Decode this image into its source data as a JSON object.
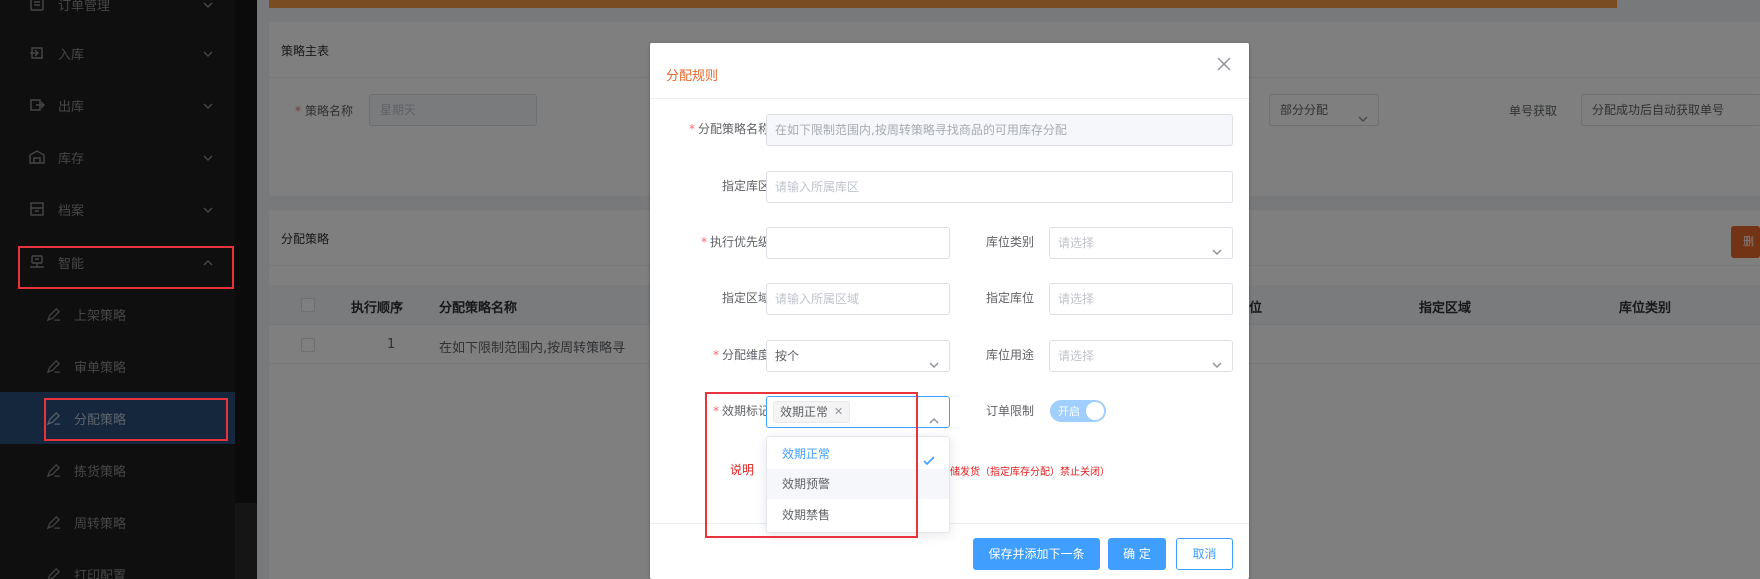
{
  "sidebar": {
    "items": [
      {
        "label": "订单管理",
        "icon": "order-icon"
      },
      {
        "label": "入库",
        "icon": "inbound-icon"
      },
      {
        "label": "出库",
        "icon": "outbound-icon"
      },
      {
        "label": "库存",
        "icon": "warehouse-icon"
      },
      {
        "label": "档案",
        "icon": "archive-icon"
      },
      {
        "label": "智能",
        "icon": "smart-icon"
      }
    ],
    "sub_items": [
      {
        "label": "上架策略",
        "icon": "edit-icon"
      },
      {
        "label": "审单策略",
        "icon": "edit-icon"
      },
      {
        "label": "分配策略",
        "icon": "edit-icon"
      },
      {
        "label": "拣货策略",
        "icon": "edit-icon"
      },
      {
        "label": "周转策略",
        "icon": "edit-icon"
      },
      {
        "label": "打印配置",
        "icon": "edit-icon"
      }
    ],
    "active_sub": "分配策略"
  },
  "background": {
    "card1_title": "策略主表",
    "strategy_name_label": "策略名称",
    "strategy_name_value": "星期天",
    "partial_alloc_value": "部分分配",
    "order_no_label": "单号获取",
    "order_no_value": "分配成功后自动获取单号",
    "card2_title": "分配策略",
    "table_headers": [
      "执行顺序",
      "分配策略名称",
      "位",
      "指定区域",
      "库位类别"
    ],
    "table_row": {
      "order": "1",
      "name": "在如下限制范围内,按周转策略寻"
    },
    "delete_label": "删"
  },
  "dialog": {
    "title": "分配规则",
    "fields": {
      "strategy_name": {
        "label": "分配策略名称",
        "value": "在如下限制范围内,按周转策略寻找商品的可用库存分配"
      },
      "zone_area": {
        "label": "指定库区",
        "placeholder": "请输入所属库区"
      },
      "priority": {
        "label": "执行优先级",
        "value": ""
      },
      "location_type": {
        "label": "库位类别",
        "placeholder": "请选择"
      },
      "region": {
        "label": "指定区域",
        "placeholder": "请输入所属区域"
      },
      "location": {
        "label": "指定库位",
        "placeholder": "请选择"
      },
      "dimension": {
        "label": "分配维度",
        "value": "按个"
      },
      "location_usage": {
        "label": "库位用途",
        "placeholder": "请选择"
      },
      "expiry_mark": {
        "label": "效期标记",
        "tag": "效期正常"
      },
      "order_limit": {
        "label": "订单限制",
        "switch_text": "开启"
      }
    },
    "note_label": "说明",
    "note_text": "储发货（指定库存分配）禁止关闭）",
    "buttons": {
      "save_next": "保存并添加下一条",
      "confirm": "确 定",
      "cancel": "取消"
    },
    "dropdown_options": [
      {
        "label": "效期正常",
        "selected": true
      },
      {
        "label": "效期预警",
        "selected": false
      },
      {
        "label": "效期禁售",
        "selected": false
      }
    ]
  },
  "colors": {
    "accent_orange": "#e6672a",
    "primary_blue": "#409eff",
    "highlight_red": "#e8323c",
    "sidebar_bg": "#1f1f1f",
    "sidebar_active": "#2a4e7a"
  }
}
